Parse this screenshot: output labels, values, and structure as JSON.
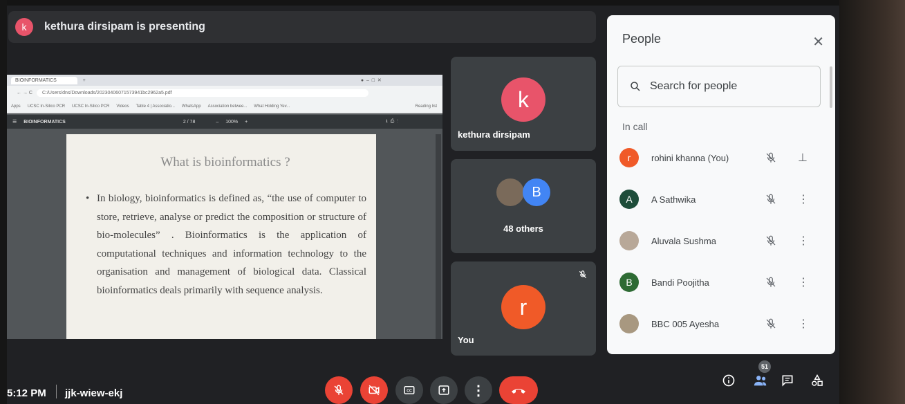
{
  "banner": {
    "avatar_letter": "k",
    "text": "kethura dirsipam is presenting"
  },
  "browser": {
    "tab_title": "BIOINFORMATICS",
    "url": "C:/Users/dns/Downloads/20230406071573941bc2962a5.pdf",
    "bookmarks": [
      "Apps",
      "UCSC In-Silico PCR",
      "UCSC In-Silico PCR",
      "Videos",
      "Table 4 | Associatio...",
      "WhatsApp",
      "Association betwee...",
      "What Holding Yev..."
    ],
    "reading_list": "Reading list"
  },
  "pdf": {
    "title": "BIOINFORMATICS",
    "page": "2 / 78",
    "zoom": "100%"
  },
  "slide": {
    "title": "What is bioinformatics ?",
    "bullet": "•",
    "body": "In biology, bioinformatics is defined as, “the use of computer to store, retrieve, analyse or predict the composition or structure of bio-molecules” . Bioinformatics is the application of computational techniques and information technology to the organisation and management of biological data. Classical bioinformatics deals primarily with sequence analysis."
  },
  "tiles": {
    "presenter": {
      "letter": "k",
      "name": "kethura dirsipam",
      "color": "#e8546a"
    },
    "others": {
      "letter": "B",
      "label": "48 others",
      "color": "#4285f4"
    },
    "self": {
      "letter": "r",
      "name": "You",
      "color": "#f05a28"
    }
  },
  "people": {
    "title": "People",
    "search_placeholder": "Search for people",
    "section": "In call",
    "members": [
      {
        "letter": "r",
        "name": "rohini khanna (You)",
        "color": "#f05a28",
        "action": "pin-icon"
      },
      {
        "letter": "A",
        "name": "A Sathwika",
        "color": "#1e4d3a",
        "action": "more-icon"
      },
      {
        "letter": "",
        "name": "Aluvala Sushma",
        "color": "#b8a898",
        "action": "more-icon"
      },
      {
        "letter": "B",
        "name": "Bandi Poojitha",
        "color": "#2e6b34",
        "action": "more-icon"
      },
      {
        "letter": "",
        "name": "BBC 005 Ayesha",
        "color": "#a89880",
        "action": "more-icon"
      }
    ]
  },
  "bottom": {
    "time": "5:12 PM",
    "meeting_code": "jjk-wiew-ekj",
    "participant_count": "51"
  }
}
